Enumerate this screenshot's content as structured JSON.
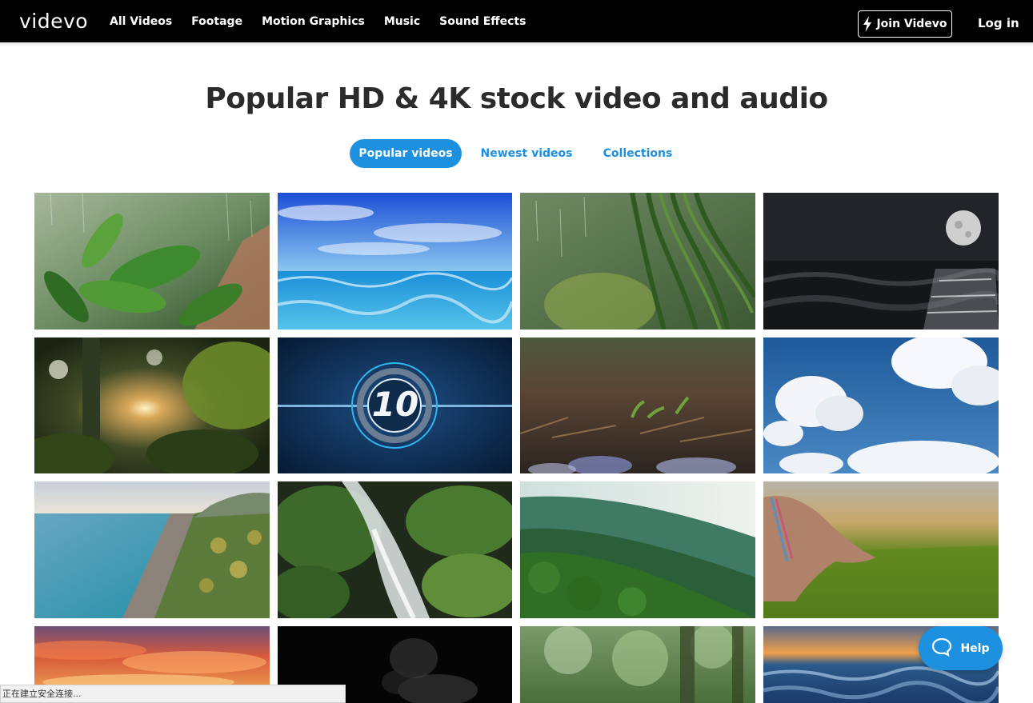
{
  "header": {
    "logo": "videvo",
    "nav": [
      "All Videos",
      "Footage",
      "Motion Graphics",
      "Music",
      "Sound Effects"
    ],
    "join_label": "Join Videvo",
    "login_label": "Log in"
  },
  "main": {
    "headline": "Popular HD & 4K stock video and audio",
    "tabs": [
      {
        "label": "Popular videos",
        "active": true
      },
      {
        "label": "Newest videos",
        "active": false
      },
      {
        "label": "Collections",
        "active": false
      }
    ]
  },
  "thumbnails": [
    {
      "scene": "rain-on-leaves"
    },
    {
      "scene": "ocean-blue-sky"
    },
    {
      "scene": "willow-rain"
    },
    {
      "scene": "moon-over-sea"
    },
    {
      "scene": "jungle-sunlight"
    },
    {
      "scene": "countdown-10",
      "overlay_text": "10"
    },
    {
      "scene": "sprouts-in-mud"
    },
    {
      "scene": "clouds-blue-sky"
    },
    {
      "scene": "aerial-beach-palms"
    },
    {
      "scene": "jungle-waterfall"
    },
    {
      "scene": "misty-green-hills"
    },
    {
      "scene": "hand-in-rice-field"
    },
    {
      "scene": "sunset-clouds"
    },
    {
      "scene": "smoke-on-black"
    },
    {
      "scene": "forest-bokeh"
    },
    {
      "scene": "sunset-ocean-waves"
    }
  ],
  "help_label": "Help",
  "status_text": "正在建立安全连接..."
}
